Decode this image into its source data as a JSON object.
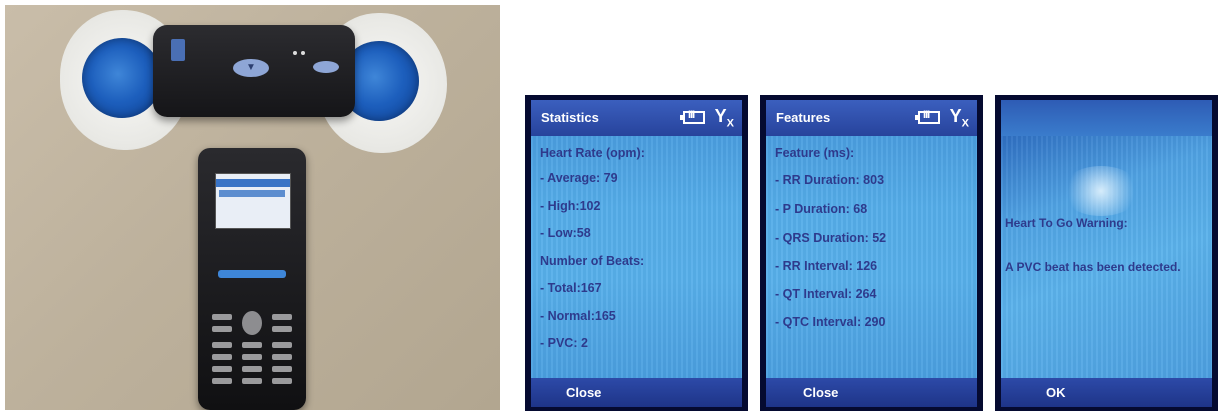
{
  "photo": {
    "sensor_button_glyph": "▼"
  },
  "screens": {
    "statistics": {
      "title": "Statistics",
      "rows": [
        "Heart Rate (opm):",
        " - Average: 79",
        " - High:102",
        " - Low:58",
        "Number of Beats:",
        " - Total:167",
        " - Normal:165",
        " - PVC: 2"
      ],
      "softkey": "Close"
    },
    "features": {
      "title": "Features",
      "rows": [
        "Feature (ms):",
        " - RR Duration: 803",
        " - P Duration: 68",
        " - QRS Duration: 52",
        " - RR Interval: 126",
        " - QT Interval: 264",
        " - QTC Interval: 290"
      ],
      "softkey": "Close"
    },
    "warning": {
      "heading": "Heart To Go Warning:",
      "message": "A PVC beat has been detected.",
      "softkey": "OK"
    }
  },
  "colors": {
    "title_bar": "#27439c",
    "content_bg": "#55ade9",
    "text": "#2e3a8c"
  }
}
